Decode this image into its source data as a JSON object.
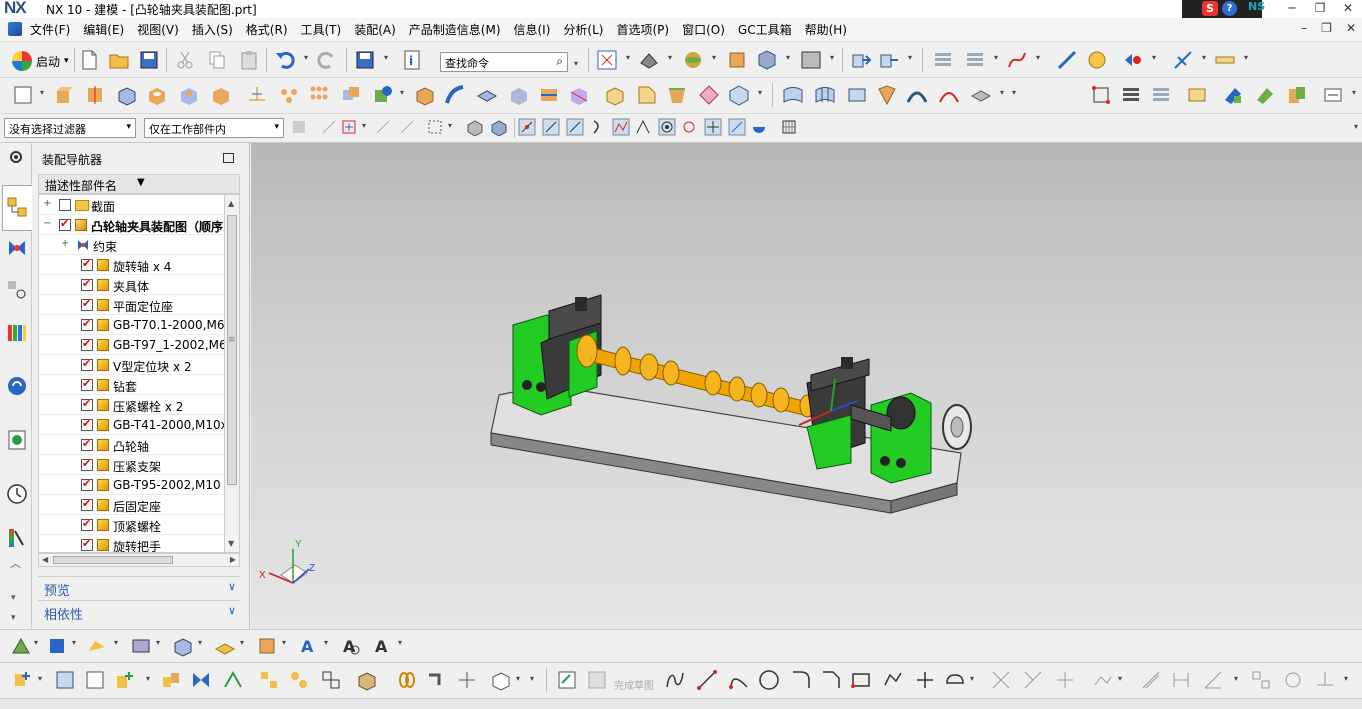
{
  "window": {
    "logo": "NX",
    "title": "NX 10 - 建模 - [凸轮轴夹具装配图.prt]",
    "tray_s": "S",
    "tray_q": "?",
    "tray_ns": "NS",
    "min": "─",
    "restore": "❐",
    "close": "✕"
  },
  "menu": {
    "items": [
      "文件(F)",
      "编辑(E)",
      "视图(V)",
      "插入(S)",
      "格式(R)",
      "工具(T)",
      "装配(A)",
      "产品制造信息(M)",
      "信息(I)",
      "分析(L)",
      "首选项(P)",
      "窗口(O)",
      "GC工具箱",
      "帮助(H)"
    ],
    "inner_min": "–",
    "inner_restore": "❐",
    "inner_close": "✕"
  },
  "toolbar1": {
    "start_label": "启动",
    "start_dropdown": "▾",
    "search_placeholder": "查找命令",
    "search_icon": "⌕"
  },
  "toolbar3": {
    "filter1": "没有选择过滤器",
    "filter2": "仅在工作部件内",
    "arrow": "▾"
  },
  "navigator": {
    "title": "装配导航器",
    "column_header": "描述性部件名",
    "column_arrow": "▼",
    "rows": [
      {
        "label": "截面",
        "expand": "+",
        "checked": false,
        "kind": "folder",
        "level": 0
      },
      {
        "label": "凸轮轴夹具装配图（顺序",
        "expand": "−",
        "checked": true,
        "kind": "assembly",
        "level": 0
      },
      {
        "label": "约束",
        "expand": "+",
        "checked": null,
        "kind": "constraint",
        "level": 1
      },
      {
        "label": "旋转轴 x 4",
        "expand": "",
        "checked": true,
        "kind": "part",
        "level": 1
      },
      {
        "label": "夹具体",
        "expand": "",
        "checked": true,
        "kind": "part",
        "level": 1
      },
      {
        "label": "平面定位座",
        "expand": "",
        "checked": true,
        "kind": "part",
        "level": 1
      },
      {
        "label": "GB-T70.1-2000,M6:",
        "expand": "",
        "checked": true,
        "kind": "part",
        "level": 1
      },
      {
        "label": "GB-T97_1-2002,M6",
        "expand": "",
        "checked": true,
        "kind": "part",
        "level": 1
      },
      {
        "label": "V型定位块 x 2",
        "expand": "",
        "checked": true,
        "kind": "part",
        "level": 1
      },
      {
        "label": "钻套",
        "expand": "",
        "checked": true,
        "kind": "part",
        "level": 1
      },
      {
        "label": "压紧螺栓 x 2",
        "expand": "",
        "checked": true,
        "kind": "part",
        "level": 1
      },
      {
        "label": "GB-T41-2000,M10x",
        "expand": "",
        "checked": true,
        "kind": "part",
        "level": 1
      },
      {
        "label": "凸轮轴",
        "expand": "",
        "checked": true,
        "kind": "part",
        "level": 1
      },
      {
        "label": "压紧支架",
        "expand": "",
        "checked": true,
        "kind": "part",
        "level": 1
      },
      {
        "label": "GB-T95-2002,M10",
        "expand": "",
        "checked": true,
        "kind": "part",
        "level": 1
      },
      {
        "label": "后固定座",
        "expand": "",
        "checked": true,
        "kind": "part",
        "level": 1
      },
      {
        "label": "顶紧螺栓",
        "expand": "",
        "checked": true,
        "kind": "part",
        "level": 1
      },
      {
        "label": "旋转把手",
        "expand": "",
        "checked": true,
        "kind": "part",
        "level": 1
      }
    ],
    "scroll_up": "▲",
    "scroll_down": "▼",
    "scroll_left": "◀",
    "scroll_right": "▶",
    "sections": [
      {
        "label": "预览",
        "chev": "∨"
      },
      {
        "label": "相依性",
        "chev": "∨"
      }
    ]
  },
  "viewport": {
    "triad_x": "X",
    "triad_y": "Y",
    "triad_z": "Z"
  },
  "bottom": {
    "sketch_label": "完成草图"
  },
  "colors": {
    "green": "#22cc22",
    "gold": "#f0a500",
    "dark": "#3a3a3a",
    "plate": "#dcdcdc"
  }
}
